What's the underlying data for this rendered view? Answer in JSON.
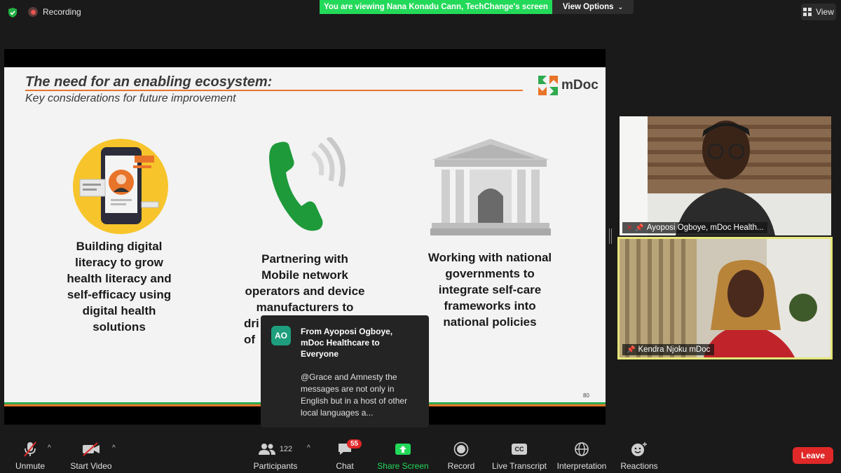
{
  "top": {
    "recording_label": "Recording",
    "viewing_banner": "You are viewing Nana Konadu Cann, TechChange's screen",
    "view_options_label": "View Options",
    "view_label": "View"
  },
  "slide": {
    "title": "The need for an enabling ecosystem:",
    "subtitle": "Key considerations for future improvement",
    "logo_text": "mDoc",
    "page_number": "80",
    "columns": [
      {
        "lines": [
          "Building digital",
          "literacy to grow",
          "health literacy and",
          "self-efficacy using",
          "digital health",
          "solutions"
        ]
      },
      {
        "lines": [
          "Partnering with",
          "Mobile network",
          "operators and device",
          "manufacturers to",
          "dri",
          "of"
        ]
      },
      {
        "lines": [
          "Working with national",
          "governments to",
          "integrate self-care",
          "frameworks into",
          "national policies"
        ]
      }
    ]
  },
  "participants": [
    {
      "name": "Ayoposi Ogboye, mDoc Health..."
    },
    {
      "name": "Kendra Njoku mDoc"
    }
  ],
  "chat_popup": {
    "avatar_initials": "AO",
    "from_lines": [
      "From Ayoposi Ogboye,",
      "mDoc Healthcare to",
      "Everyone"
    ],
    "message_lines": [
      "@Grace and Amnesty the",
      "messages are not only in",
      "English  but in a host of other",
      "local languages a..."
    ]
  },
  "toolbar": {
    "unmute": "Unmute",
    "start_video": "Start Video",
    "participants": "Participants",
    "participant_count": "122",
    "chat": "Chat",
    "chat_badge": "55",
    "share_screen": "Share Screen",
    "record": "Record",
    "live_transcript": "Live Transcript",
    "cc_label": "CC",
    "interpretation": "Interpretation",
    "reactions": "Reactions",
    "leave": "Leave"
  },
  "colors": {
    "share_green": "#23d959",
    "leave_red": "#e02828",
    "slide_orange": "#e8742a",
    "phone_green": "#1e9a3a"
  }
}
